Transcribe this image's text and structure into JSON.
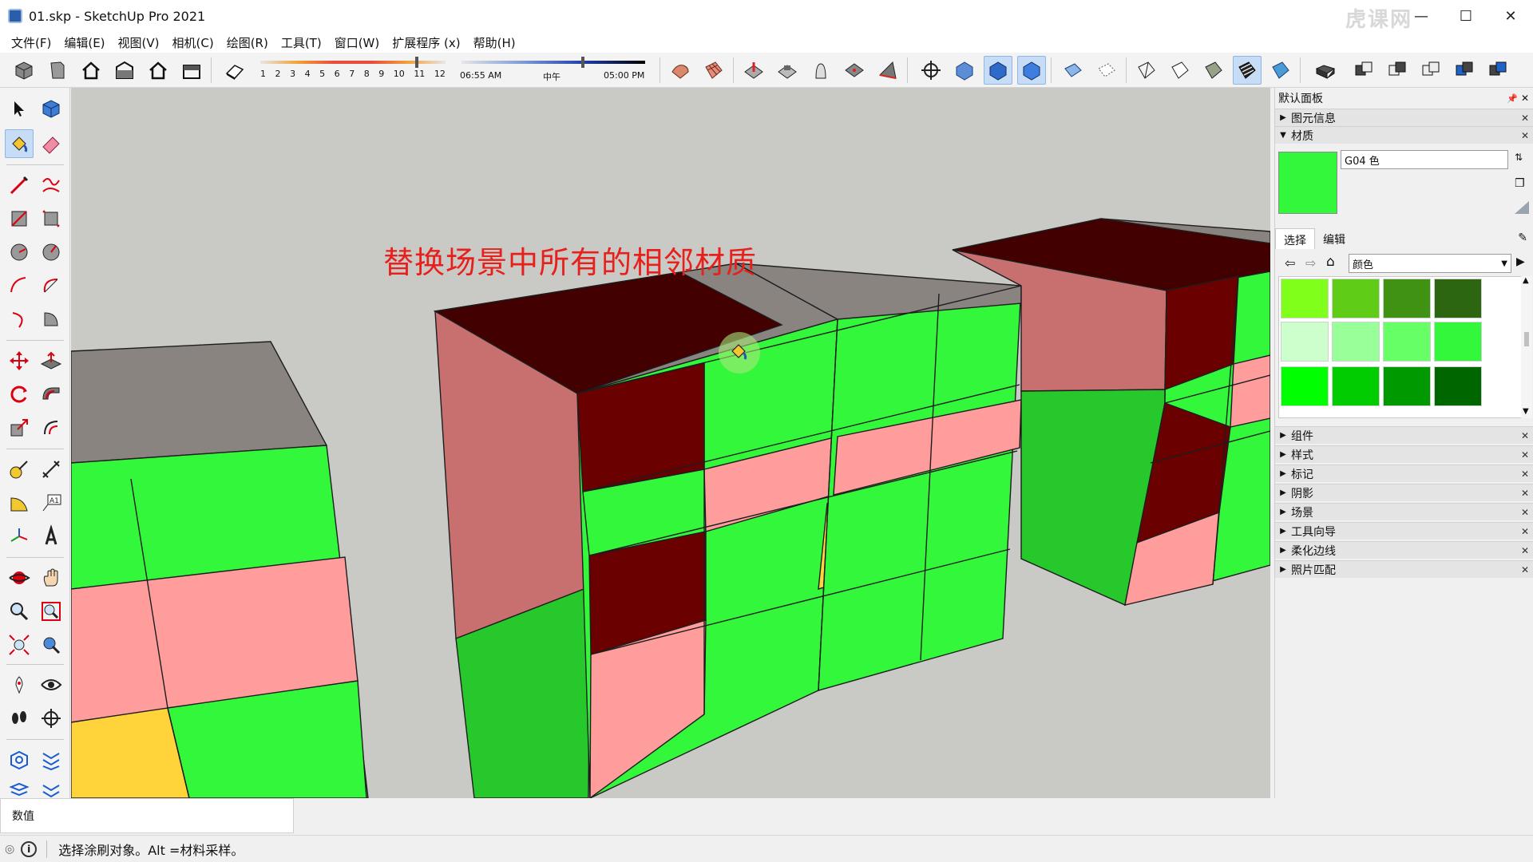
{
  "window": {
    "title": "01.skp - SketchUp Pro 2021",
    "minimize": "—",
    "maximize": "☐",
    "close": "✕"
  },
  "menu": [
    "文件(F)",
    "编辑(E)",
    "视图(V)",
    "相机(C)",
    "绘图(R)",
    "工具(T)",
    "窗口(W)",
    "扩展程序 (x)",
    "帮助(H)"
  ],
  "shadow": {
    "months": [
      "1",
      "2",
      "3",
      "4",
      "5",
      "6",
      "7",
      "8",
      "9",
      "10",
      "11",
      "12"
    ],
    "time_start": "06:55 AM",
    "time_mid": "中午",
    "time_end": "05:00 PM"
  },
  "viewport": {
    "annotation": "替换场景中所有的相邻材质",
    "colors": {
      "green": "#33f73a",
      "green_side": "#26c82c",
      "pink": "#ff9d9d",
      "pink_side": "#c87070",
      "dark_red": "#6b0000",
      "dark_red_top": "#420000",
      "yellow": "#ffd43a",
      "stone": "#8a8480",
      "ground": "#c9c9c6"
    }
  },
  "measurements": {
    "label": "数值"
  },
  "status": {
    "text": "选择涂刷对象。Alt =材料采样。"
  },
  "panel": {
    "title": "默认面板",
    "entity_info": "图元信息",
    "materials": "材质",
    "material_name": "G04 色",
    "tab_select": "选择",
    "tab_edit": "编辑",
    "category": "颜色",
    "swatches": [
      "#80ff1a",
      "#5fcc18",
      "#3f9212",
      "#2d6610",
      "#ccffcc",
      "#99ff99",
      "#66ff66",
      "#33f73a",
      "#00ff00",
      "#00cc00",
      "#009900",
      "#006600"
    ],
    "sections": [
      "组件",
      "样式",
      "标记",
      "阴影",
      "场景",
      "工具向导",
      "柔化边线",
      "照片匹配"
    ]
  },
  "watermark": "虎课网"
}
